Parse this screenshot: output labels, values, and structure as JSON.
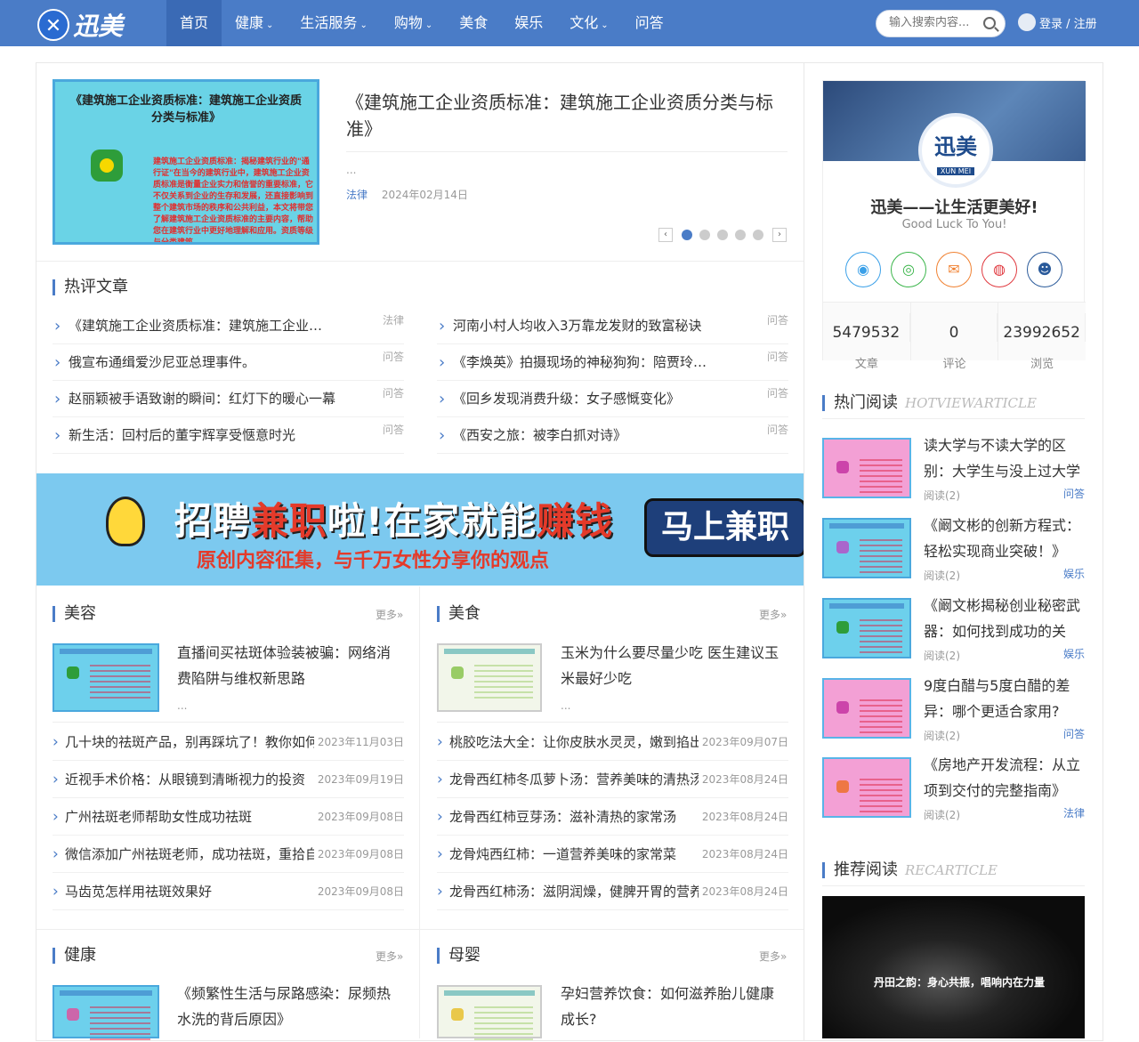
{
  "header": {
    "logo_text": "迅美",
    "nav": [
      {
        "label": "首页",
        "caret": ""
      },
      {
        "label": "健康",
        "caret": "⌄"
      },
      {
        "label": "生活服务",
        "caret": "⌄"
      },
      {
        "label": "购物",
        "caret": "⌄"
      },
      {
        "label": "美食",
        "caret": ""
      },
      {
        "label": "娱乐",
        "caret": ""
      },
      {
        "label": "文化",
        "caret": "⌄"
      },
      {
        "label": "问答",
        "caret": ""
      }
    ],
    "search_placeholder": "输入搜索内容...",
    "login": "登录 / 注册"
  },
  "slider": {
    "image_title": "《建筑施工企业资质标准：建筑施工企业资质分类与标准》",
    "image_body": "建筑施工企业资质标准：揭秘建筑行业的\"通行证\"在当今的建筑行业中，建筑施工企业资质标准是衡量企业实力和信誉的重要标准，它不仅关系到企业的生存和发展，还直接影响到整个建筑市场的秩序和公共利益，本文将带您了解建筑施工企业资质标准的主要内容，帮助您在建筑行业中更好地理解和应用。资质等级与分类建筑",
    "title": "《建筑施工企业资质标准：建筑施工企业资质分类与标准》",
    "excerpt": "...",
    "category": "法律",
    "date": "2024年02月14日",
    "prev": "‹",
    "next": "›"
  },
  "hot_comment": {
    "title": "热评文章",
    "left": [
      {
        "text": "《建筑施工企业资质标准：建筑施工企业资质分类与标准》",
        "tag": "法律"
      },
      {
        "text": "俄宣布通缉爱沙尼亚总理事件。",
        "tag": "问答"
      },
      {
        "text": "赵丽颖被手语致谢的瞬间：红灯下的暖心一幕",
        "tag": "问答"
      },
      {
        "text": "新生活：回村后的董宇辉享受惬意时光",
        "tag": "问答"
      }
    ],
    "right": [
      {
        "text": "河南小村人均收入3万靠龙发财的致富秘诀",
        "tag": "问答"
      },
      {
        "text": "《李焕英》拍摄现场的神秘狗狗：陪贾玲的暖心伙伴",
        "tag": "问答"
      },
      {
        "text": "《回乡发现消费升级：女子感慨变化》",
        "tag": "问答"
      },
      {
        "text": "《西安之旅：被李白抓对诗》",
        "tag": "问答"
      }
    ]
  },
  "banner": {
    "line1_a": "招聘",
    "line1_b": "兼职",
    "line1_c": "啦!在家就能",
    "line1_d": "赚钱",
    "line2": "原创内容征集，与千万女性分享你的观点",
    "button": "马上兼职",
    "arrows": "▲▲▲▲"
  },
  "beauty": {
    "title": "美容",
    "more": "更多»",
    "feature_title": "直播间买祛斑体验装被骗：网络消费陷阱与维权新思路",
    "feature_excerpt": "...",
    "items": [
      {
        "text": "几十块的祛斑产品，别再踩坑了！教你如何挑选",
        "date": "2023年11月03日"
      },
      {
        "text": "近视手术价格：从眼镜到清晰视力的投资",
        "date": "2023年09月19日"
      },
      {
        "text": "广州祛斑老师帮助女性成功祛斑",
        "date": "2023年09月08日"
      },
      {
        "text": "微信添加广州祛斑老师，成功祛斑，重拾自信",
        "date": "2023年09月08日"
      },
      {
        "text": "马齿苋怎样用祛斑效果好",
        "date": "2023年09月08日"
      }
    ]
  },
  "food": {
    "title": "美食",
    "more": "更多»",
    "feature_title": "玉米为什么要尽量少吃 医生建议玉米最好少吃",
    "feature_excerpt": "...",
    "items": [
      {
        "text": "桃胶吃法大全：让你皮肤水灵灵，嫩到掐出水",
        "date": "2023年09月07日"
      },
      {
        "text": "龙骨西红柿冬瓜萝卜汤：营养美味的清热汤品",
        "date": "2023年08月24日"
      },
      {
        "text": "龙骨西红柿豆芽汤：滋补清热的家常汤",
        "date": "2023年08月24日"
      },
      {
        "text": "龙骨炖西红柿：一道营养美味的家常菜",
        "date": "2023年08月24日"
      },
      {
        "text": "龙骨西红柿汤：滋阴润燥，健脾开胃的营养汤",
        "date": "2023年08月24日"
      }
    ]
  },
  "health": {
    "title": "健康",
    "more": "更多»",
    "feature_title": "《频繁性生活与尿路感染：尿频热水洗的背后原因》"
  },
  "baby": {
    "title": "母婴",
    "more": "更多»",
    "feature_title": "孕妇营养饮食：如何滋养胎儿健康成长?"
  },
  "profile": {
    "avatar_text": "迅美",
    "avatar_sub": "XUN MEI",
    "name": "迅美——让生活更美好!",
    "slogan": "Good Luck To You!",
    "socials": [
      "qq-icon",
      "wechat-icon",
      "mail-icon",
      "weibo-icon",
      "user-icon"
    ],
    "stats": [
      {
        "num": "5479532",
        "label": "文章"
      },
      {
        "num": "0",
        "label": "评论"
      },
      {
        "num": "23992652",
        "label": "浏览"
      }
    ]
  },
  "hot_view": {
    "title": "热门阅读",
    "title_en": "HOTVIEWARTICLE",
    "items": [
      {
        "title": "读大学与不读大学的区别：大学生与没上过大学的人的差异",
        "reads": "阅读(2)",
        "cat": "问答"
      },
      {
        "title": "《阚文彬的创新方程式：轻松实现商业突破！》",
        "reads": "阅读(2)",
        "cat": "娱乐"
      },
      {
        "title": "《阚文彬揭秘创业秘密武器：如何找到成功的关键》",
        "reads": "阅读(2)",
        "cat": "娱乐"
      },
      {
        "title": "9度白醋与5度白醋的差异：哪个更适合家用?",
        "reads": "阅读(2)",
        "cat": "问答"
      },
      {
        "title": "《房地产开发流程：从立项到交付的完整指南》",
        "reads": "阅读(2)",
        "cat": "法律"
      }
    ]
  },
  "recommend": {
    "title": "推荐阅读",
    "title_en": "RECARTICLE",
    "image_caption": "丹田之韵：身心共振，唱响内在力量"
  }
}
